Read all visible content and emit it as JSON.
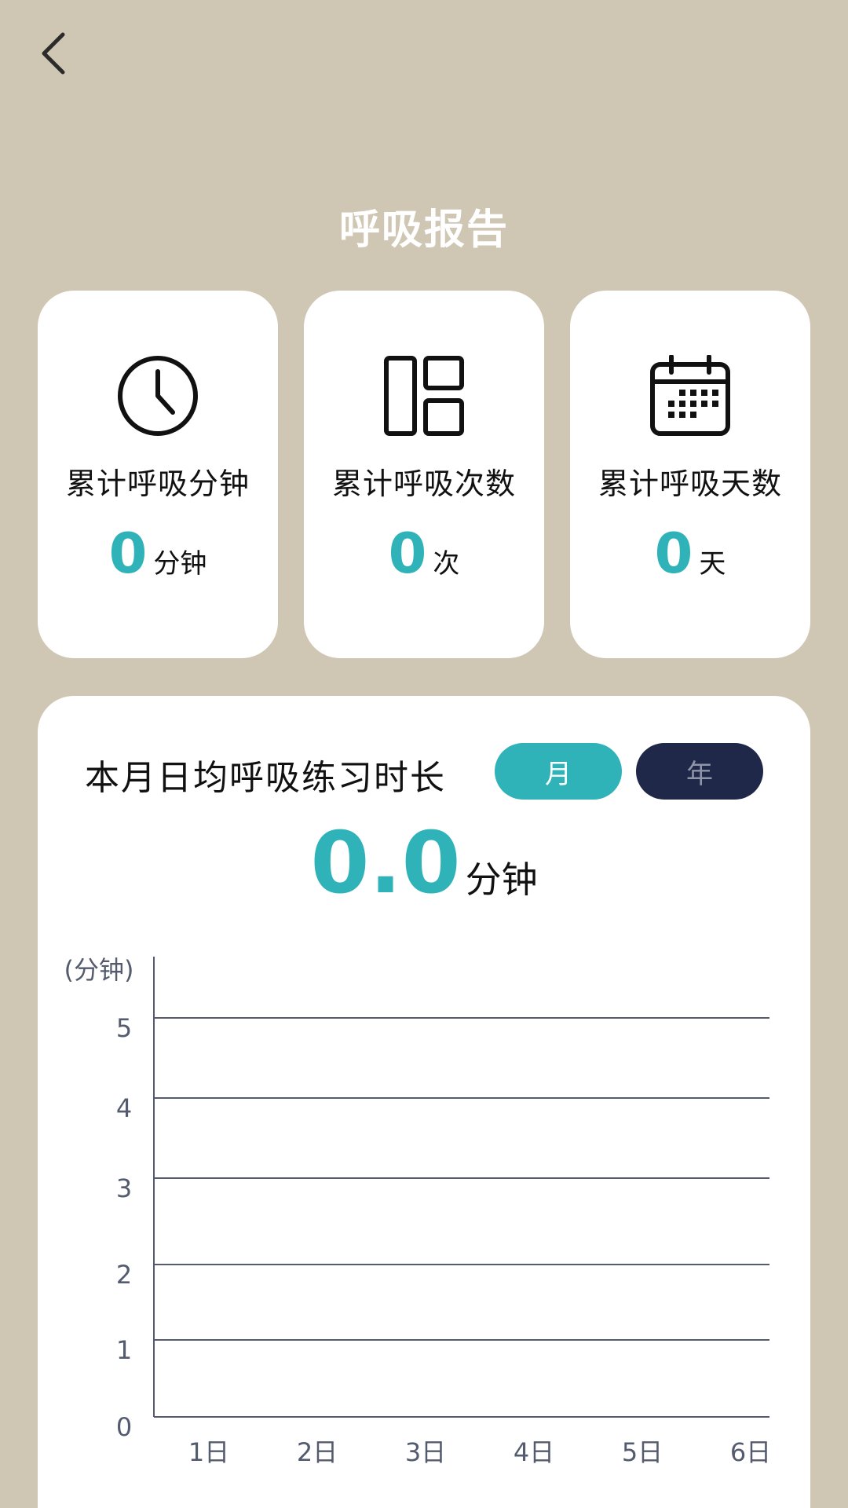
{
  "header": {
    "back_icon": "chevron-left-icon",
    "title": "呼吸报告"
  },
  "stats": [
    {
      "icon": "clock-icon",
      "label": "累计呼吸分钟",
      "value": "0",
      "unit": "分钟"
    },
    {
      "icon": "layout-grid-icon",
      "label": "累计呼吸次数",
      "value": "0",
      "unit": "次"
    },
    {
      "icon": "calendar-icon",
      "label": "累计呼吸天数",
      "value": "0",
      "unit": "天"
    }
  ],
  "chart_section": {
    "title": "本月日均呼吸练习时长",
    "toggle_month": "月",
    "toggle_year": "年",
    "average_value": "0.0",
    "average_unit": "分钟"
  },
  "colors": {
    "background": "#cfc7b4",
    "accent": "#2fb3b9",
    "dark_button": "#1f2849"
  },
  "chart_data": {
    "type": "line",
    "ylabel": "(分钟)",
    "categories": [
      "1日",
      "2日",
      "3日",
      "4日",
      "5日",
      "6日"
    ],
    "y_ticks": [
      "0",
      "1",
      "2",
      "3",
      "4",
      "5"
    ],
    "ylim": [
      0,
      5
    ],
    "grid": true,
    "series": [
      {
        "values": [
          0,
          0,
          0,
          0,
          0,
          0
        ]
      }
    ]
  }
}
